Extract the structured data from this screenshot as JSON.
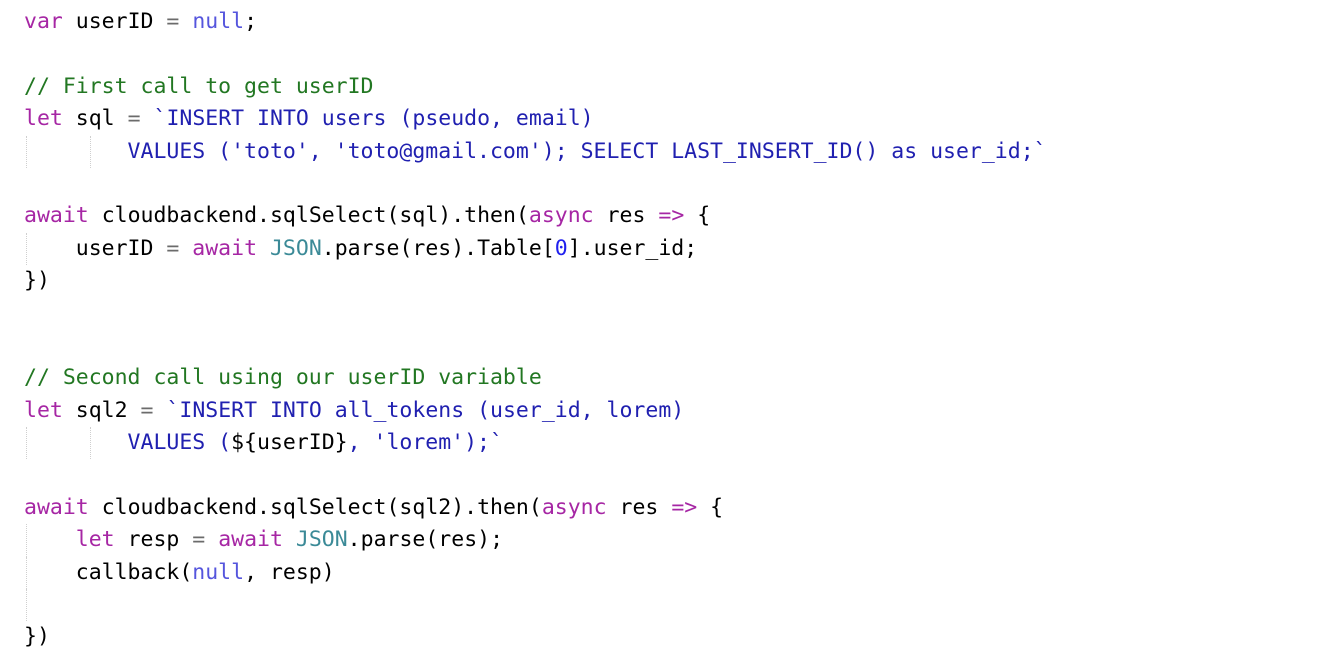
{
  "editor": {
    "language": "javascript",
    "background_color": "#ffffff",
    "font_size_px": 21.5,
    "indent_guides": true,
    "colors": {
      "keyword": "#a626a4",
      "string": "#2020b0",
      "number": "#2020ee",
      "null": "#5555dd",
      "comment": "#227722",
      "class": "#3b8a97",
      "operator": "#6b6b6b",
      "plain": "#000000",
      "indent_guide": "#cfcfcf"
    }
  },
  "code": {
    "full_text": "var userID = null;\n\n// First call to get userID\nlet sql = `INSERT INTO users (pseudo, email)\n        VALUES ('toto', 'toto@gmail.com'); SELECT LAST_INSERT_ID() as user_id;`\n\nawait cloudbackend.sqlSelect(sql).then(async res => {\n    userID = await JSON.parse(res).Table[0].user_id;\n})\n\n\n// Second call using our userID variable\nlet sql2 = `INSERT INTO all_tokens (user_id, lorem)\n        VALUES (${userID}, 'lorem');`\n\nawait cloudbackend.sqlSelect(sql2).then(async res => {\n    let resp = await JSON.parse(res);\n    callback(null, resp)\n\n})",
    "lines": [
      {
        "n": 1,
        "guides": [],
        "tokens": [
          {
            "t": "var",
            "c": "kw"
          },
          {
            "t": " ",
            "c": "pln"
          },
          {
            "t": "userID",
            "c": "pln"
          },
          {
            "t": " ",
            "c": "pln"
          },
          {
            "t": "=",
            "c": "op"
          },
          {
            "t": " ",
            "c": "pln"
          },
          {
            "t": "null",
            "c": "nul"
          },
          {
            "t": ";",
            "c": "pln"
          }
        ]
      },
      {
        "n": 2,
        "guides": [],
        "tokens": []
      },
      {
        "n": 3,
        "guides": [],
        "tokens": [
          {
            "t": "// First call to get userID",
            "c": "cmt"
          }
        ]
      },
      {
        "n": 4,
        "guides": [],
        "tokens": [
          {
            "t": "let",
            "c": "kw"
          },
          {
            "t": " ",
            "c": "pln"
          },
          {
            "t": "sql",
            "c": "pln"
          },
          {
            "t": " ",
            "c": "pln"
          },
          {
            "t": "=",
            "c": "op"
          },
          {
            "t": " ",
            "c": "pln"
          },
          {
            "t": "`INSERT INTO users (pseudo, email)",
            "c": "str"
          }
        ]
      },
      {
        "n": 5,
        "guides": [
          "g1",
          "g2"
        ],
        "tokens": [
          {
            "t": "        VALUES ('toto', 'toto@gmail.com'); SELECT LAST_INSERT_ID() as user_id;`",
            "c": "str"
          }
        ]
      },
      {
        "n": 6,
        "guides": [],
        "tokens": []
      },
      {
        "n": 7,
        "guides": [],
        "tokens": [
          {
            "t": "await",
            "c": "kw"
          },
          {
            "t": " ",
            "c": "pln"
          },
          {
            "t": "cloudbackend",
            "c": "pln"
          },
          {
            "t": ".",
            "c": "pln"
          },
          {
            "t": "sqlSelect",
            "c": "pln"
          },
          {
            "t": "(sql).",
            "c": "pln"
          },
          {
            "t": "then",
            "c": "pln"
          },
          {
            "t": "(",
            "c": "pln"
          },
          {
            "t": "async",
            "c": "kw"
          },
          {
            "t": " ",
            "c": "pln"
          },
          {
            "t": "res",
            "c": "pln"
          },
          {
            "t": " ",
            "c": "pln"
          },
          {
            "t": "=>",
            "c": "kw"
          },
          {
            "t": " {",
            "c": "pln"
          }
        ]
      },
      {
        "n": 8,
        "guides": [
          "g1"
        ],
        "tokens": [
          {
            "t": "    userID ",
            "c": "pln"
          },
          {
            "t": "=",
            "c": "op"
          },
          {
            "t": " ",
            "c": "pln"
          },
          {
            "t": "await",
            "c": "kw"
          },
          {
            "t": " ",
            "c": "pln"
          },
          {
            "t": "JSON",
            "c": "cls"
          },
          {
            "t": ".",
            "c": "pln"
          },
          {
            "t": "parse",
            "c": "pln"
          },
          {
            "t": "(res).Table[",
            "c": "pln"
          },
          {
            "t": "0",
            "c": "num"
          },
          {
            "t": "].user_id;",
            "c": "pln"
          }
        ]
      },
      {
        "n": 9,
        "guides": [],
        "tokens": [
          {
            "t": "})",
            "c": "pln"
          }
        ]
      },
      {
        "n": 10,
        "guides": [],
        "tokens": []
      },
      {
        "n": 11,
        "guides": [],
        "tokens": []
      },
      {
        "n": 12,
        "guides": [],
        "tokens": [
          {
            "t": "// Second call using our userID variable",
            "c": "cmt"
          }
        ]
      },
      {
        "n": 13,
        "guides": [],
        "tokens": [
          {
            "t": "let",
            "c": "kw"
          },
          {
            "t": " ",
            "c": "pln"
          },
          {
            "t": "sql2",
            "c": "pln"
          },
          {
            "t": " ",
            "c": "pln"
          },
          {
            "t": "=",
            "c": "op"
          },
          {
            "t": " ",
            "c": "pln"
          },
          {
            "t": "`INSERT INTO all_tokens (user_id, lorem)",
            "c": "str"
          }
        ]
      },
      {
        "n": 14,
        "guides": [
          "g1",
          "g2"
        ],
        "tokens": [
          {
            "t": "        VALUES (",
            "c": "str"
          },
          {
            "t": "${userID}",
            "c": "pln"
          },
          {
            "t": ", 'lorem');`",
            "c": "str"
          }
        ]
      },
      {
        "n": 15,
        "guides": [],
        "tokens": []
      },
      {
        "n": 16,
        "guides": [],
        "tokens": [
          {
            "t": "await",
            "c": "kw"
          },
          {
            "t": " ",
            "c": "pln"
          },
          {
            "t": "cloudbackend",
            "c": "pln"
          },
          {
            "t": ".",
            "c": "pln"
          },
          {
            "t": "sqlSelect",
            "c": "pln"
          },
          {
            "t": "(sql2).",
            "c": "pln"
          },
          {
            "t": "then",
            "c": "pln"
          },
          {
            "t": "(",
            "c": "pln"
          },
          {
            "t": "async",
            "c": "kw"
          },
          {
            "t": " ",
            "c": "pln"
          },
          {
            "t": "res",
            "c": "pln"
          },
          {
            "t": " ",
            "c": "pln"
          },
          {
            "t": "=>",
            "c": "kw"
          },
          {
            "t": " {",
            "c": "pln"
          }
        ]
      },
      {
        "n": 17,
        "guides": [
          "g1"
        ],
        "tokens": [
          {
            "t": "    ",
            "c": "pln"
          },
          {
            "t": "let",
            "c": "kw"
          },
          {
            "t": " resp ",
            "c": "pln"
          },
          {
            "t": "=",
            "c": "op"
          },
          {
            "t": " ",
            "c": "pln"
          },
          {
            "t": "await",
            "c": "kw"
          },
          {
            "t": " ",
            "c": "pln"
          },
          {
            "t": "JSON",
            "c": "cls"
          },
          {
            "t": ".",
            "c": "pln"
          },
          {
            "t": "parse",
            "c": "pln"
          },
          {
            "t": "(res);",
            "c": "pln"
          }
        ]
      },
      {
        "n": 18,
        "guides": [
          "g1"
        ],
        "tokens": [
          {
            "t": "    callback(",
            "c": "pln"
          },
          {
            "t": "null",
            "c": "nul"
          },
          {
            "t": ", resp)",
            "c": "pln"
          }
        ]
      },
      {
        "n": 19,
        "guides": [
          "g1"
        ],
        "tokens": []
      },
      {
        "n": 20,
        "guides": [],
        "tokens": [
          {
            "t": "})",
            "c": "pln"
          }
        ]
      }
    ]
  }
}
